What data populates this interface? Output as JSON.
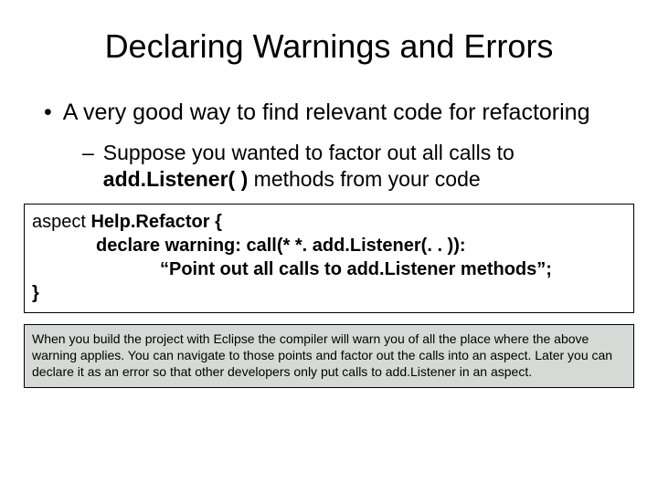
{
  "title": "Declaring Warnings and Errors",
  "bullet1": "A very good way to find relevant code for refactoring",
  "bullet2_pre": "Suppose you wanted to factor out all calls to ",
  "bullet2_bold": "add.Listener( )",
  "bullet2_post": " methods from your code",
  "code": {
    "line1_pre": "aspect ",
    "line1_bold": "Help.Refactor {",
    "line2": "declare warning: call(* *. add.Listener(. . )):",
    "line3": "“Point out all calls to add.Listener methods”;",
    "line4": "}"
  },
  "note": "When you build the project with Eclipse the compiler will warn you of all the place where the above warning applies. You can navigate to those points and factor out the calls into an aspect. Later you can declare it as an error so that other developers only put calls to add.Listener in an aspect."
}
